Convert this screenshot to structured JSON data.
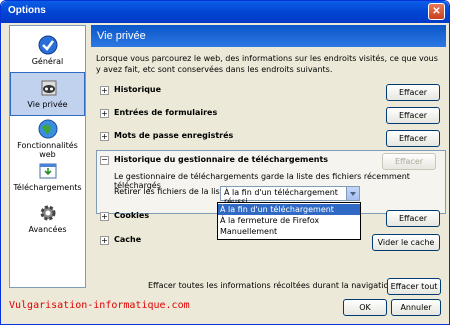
{
  "window": {
    "title": "Options",
    "close_glyph": "✕"
  },
  "sidebar": {
    "items": [
      {
        "label": "Général",
        "icon": "checkmark-icon",
        "selected": false
      },
      {
        "label": "Vie privée",
        "icon": "mask-icon",
        "selected": true
      },
      {
        "label": "Fonctionnalités web",
        "icon": "globe-icon",
        "selected": false
      },
      {
        "label": "Téléchargements",
        "icon": "download-window-icon",
        "selected": false
      },
      {
        "label": "Avancées",
        "icon": "gear-icon",
        "selected": false
      }
    ]
  },
  "main": {
    "header": "Vie privée",
    "intro": "Lorsque vous parcourez le web, des informations sur les endroits visités, ce que vous y avez fait, etc sont conservées dans les endroits suivants.",
    "sections": [
      {
        "label": "Historique",
        "button": "Effacer"
      },
      {
        "label": "Entrées de formulaires",
        "button": "Effacer"
      },
      {
        "label": "Mots de passe enregistrés",
        "button": "Effacer"
      }
    ],
    "download_history": {
      "label": "Historique du gestionnaire de téléchargements",
      "button": "Effacer",
      "description": "Le gestionnaire de téléchargements garde la liste des fichiers récemment téléchargés",
      "retain_label": "Retirer les fichiers de la liste :",
      "retain_value": "À la fin d'un téléchargement réussi",
      "options": [
        "À la fin d'un téléchargement réussi",
        "À la fermeture de  Firefox",
        "Manuellement"
      ]
    },
    "cookies": {
      "label": "Cookies",
      "button": "Effacer"
    },
    "cache": {
      "label": "Cache",
      "button": "Vider le cache"
    },
    "clear_all": {
      "label": "Effacer toutes les informations récoltées durant la navigation :",
      "button": "Effacer tout"
    }
  },
  "footer": {
    "ok": "OK",
    "cancel": "Annuler",
    "watermark": "Vulgarisation-informatique.com"
  }
}
